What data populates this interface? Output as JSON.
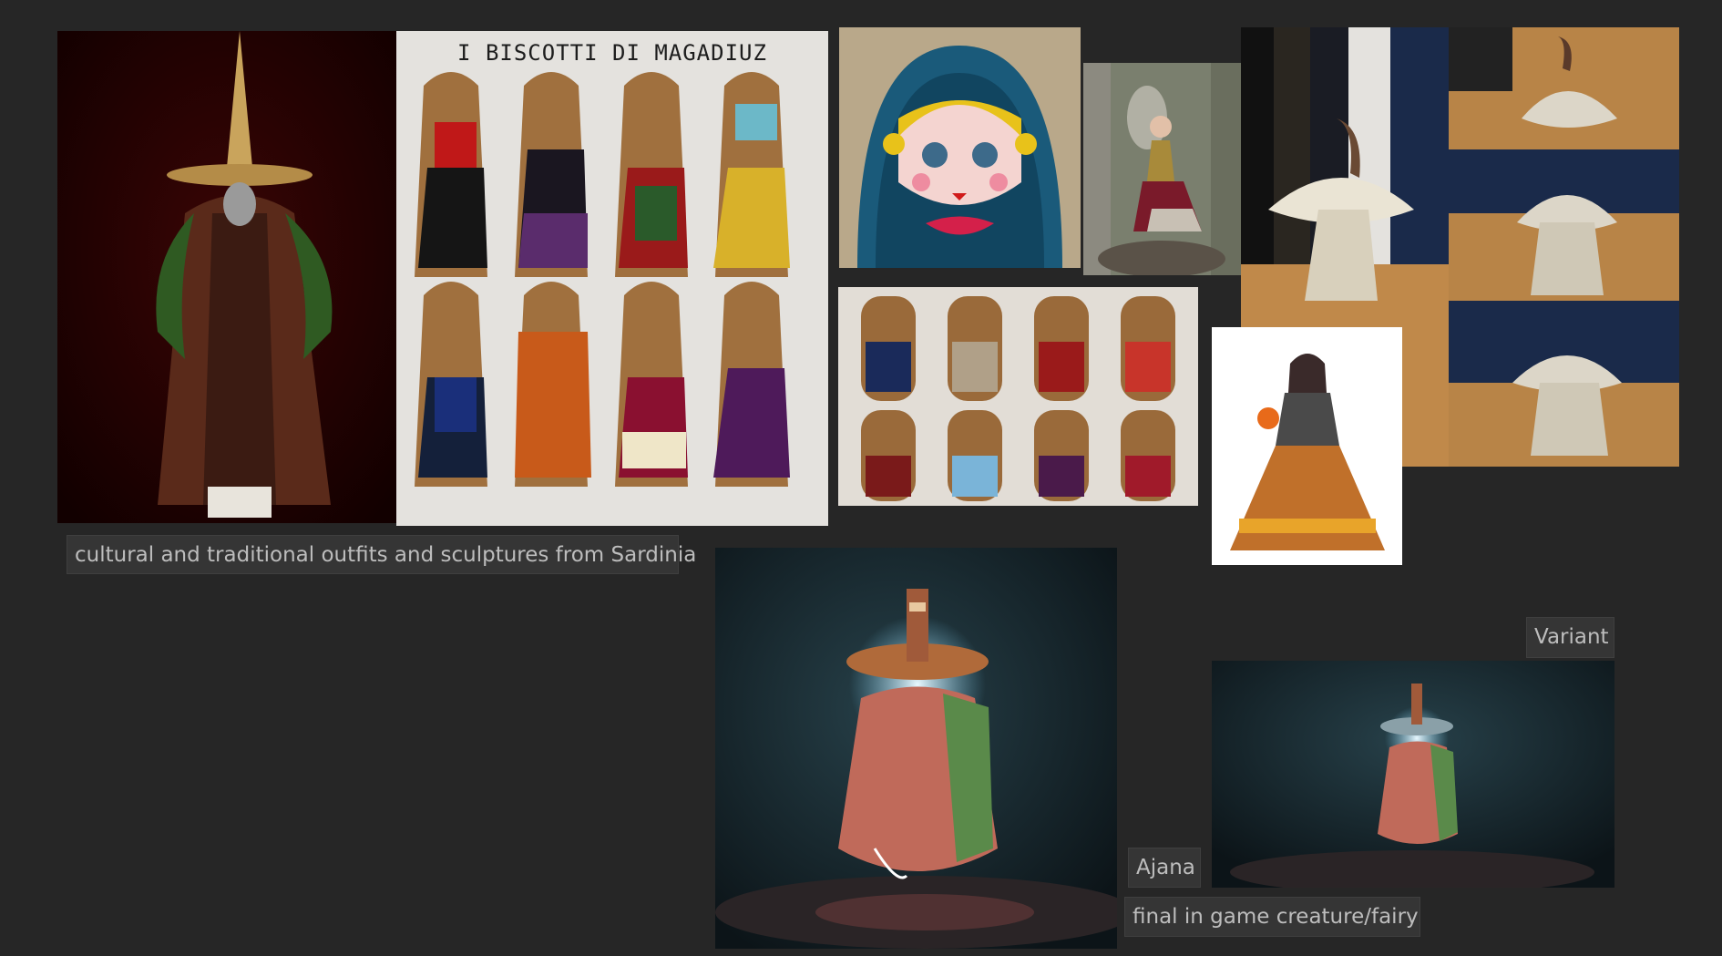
{
  "board": {
    "background": "#262626",
    "notes": {
      "caption_main": "cultural and traditional outfits and sculptures from Sardinia",
      "caption_variant": "Variant",
      "caption_name": "Ajana",
      "caption_final": "final in game creature/fairy"
    },
    "images": {
      "biscotti_title": "I BISCOTTI DI MAGADIUZ"
    }
  }
}
